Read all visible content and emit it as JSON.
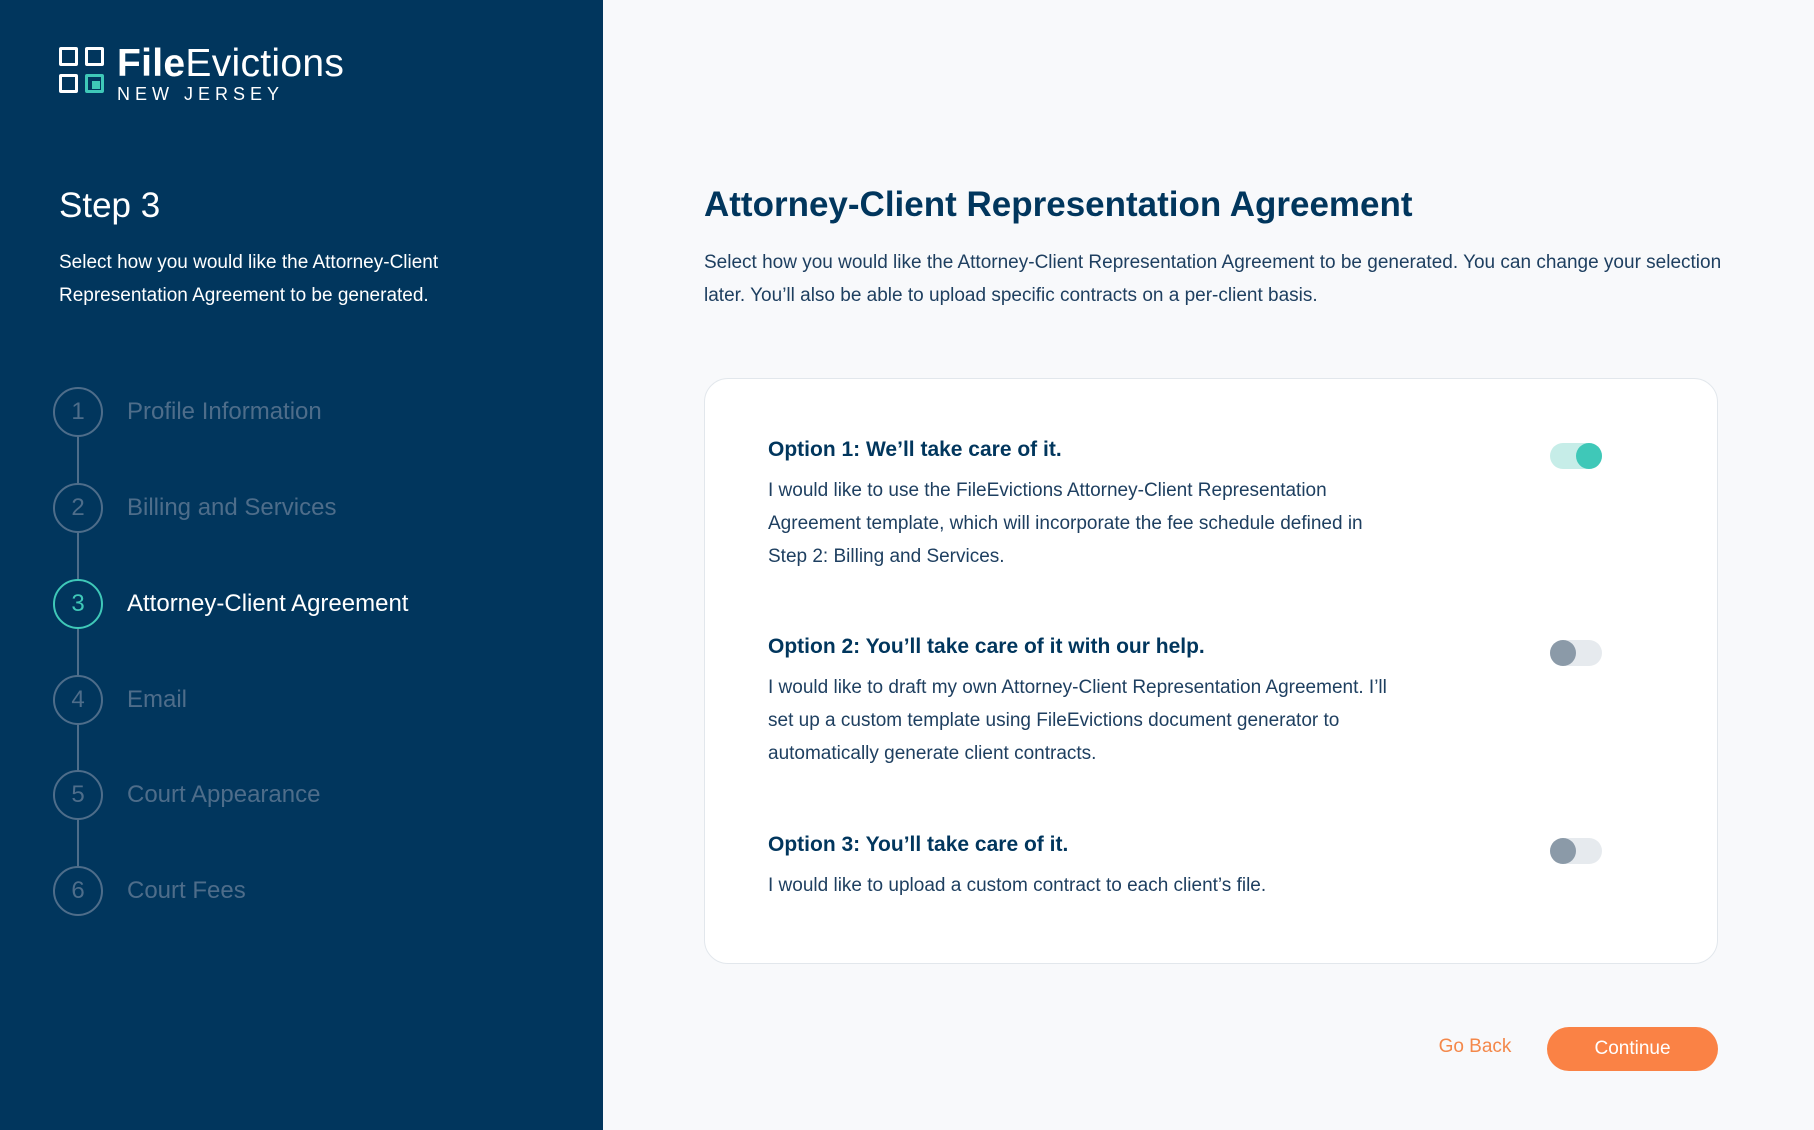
{
  "brand": {
    "name_bold": "File",
    "name_regular": "Evictions",
    "region": "NEW JERSEY",
    "accent_color": "#3fc8b8",
    "sidebar_color": "#01365d"
  },
  "sidebar": {
    "step_title": "Step 3",
    "step_description": "Select how you would like the Attorney-Client Representation Agreement to be generated.",
    "steps": [
      {
        "number": "1",
        "label": "Profile Information",
        "state": "inactive"
      },
      {
        "number": "2",
        "label": "Billing and Services",
        "state": "inactive"
      },
      {
        "number": "3",
        "label": "Attorney-Client Agreement",
        "state": "active"
      },
      {
        "number": "4",
        "label": "Email",
        "state": "inactive"
      },
      {
        "number": "5",
        "label": "Court Appearance",
        "state": "inactive"
      },
      {
        "number": "6",
        "label": "Court Fees",
        "state": "inactive"
      }
    ]
  },
  "main": {
    "title": "Attorney-Client Representation Agreement",
    "description": "Select how you would like the Attorney-Client Representation Agreement to be generated. You can change your selection later. You’ll also be able to upload specific contracts on a per-client basis.",
    "options": [
      {
        "title": "Option 1: We’ll take care of it.",
        "description": "I would like to use the FileEvictions Attorney-Client Representation Agreement template, which will incorporate the fee schedule defined in Step 2: Billing and Services.",
        "enabled": true
      },
      {
        "title": "Option 2: You’ll take care of it with our help.",
        "description": "I would like to draft my own Attorney-Client Representation Agreement. I’ll set up a custom template using FileEvictions document generator to automatically generate client contracts.",
        "enabled": false
      },
      {
        "title": "Option 3: You’ll take care of it.",
        "description": "I would like to upload a custom contract to each client’s file.",
        "enabled": false
      }
    ]
  },
  "footer": {
    "back_label": "Go Back",
    "continue_label": "Continue",
    "button_color": "#fa8245"
  }
}
